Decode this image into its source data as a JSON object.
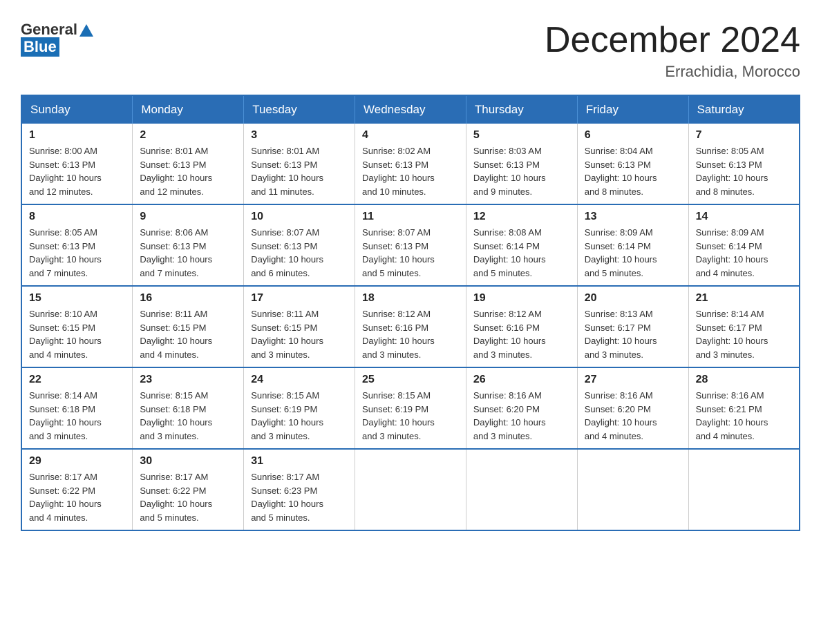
{
  "header": {
    "logo_general": "General",
    "logo_blue": "Blue",
    "month_title": "December 2024",
    "location": "Errachidia, Morocco"
  },
  "days_of_week": [
    "Sunday",
    "Monday",
    "Tuesday",
    "Wednesday",
    "Thursday",
    "Friday",
    "Saturday"
  ],
  "weeks": [
    [
      {
        "day": "1",
        "sunrise": "8:00 AM",
        "sunset": "6:13 PM",
        "daylight": "10 hours and 12 minutes."
      },
      {
        "day": "2",
        "sunrise": "8:01 AM",
        "sunset": "6:13 PM",
        "daylight": "10 hours and 12 minutes."
      },
      {
        "day": "3",
        "sunrise": "8:01 AM",
        "sunset": "6:13 PM",
        "daylight": "10 hours and 11 minutes."
      },
      {
        "day": "4",
        "sunrise": "8:02 AM",
        "sunset": "6:13 PM",
        "daylight": "10 hours and 10 minutes."
      },
      {
        "day": "5",
        "sunrise": "8:03 AM",
        "sunset": "6:13 PM",
        "daylight": "10 hours and 9 minutes."
      },
      {
        "day": "6",
        "sunrise": "8:04 AM",
        "sunset": "6:13 PM",
        "daylight": "10 hours and 8 minutes."
      },
      {
        "day": "7",
        "sunrise": "8:05 AM",
        "sunset": "6:13 PM",
        "daylight": "10 hours and 8 minutes."
      }
    ],
    [
      {
        "day": "8",
        "sunrise": "8:05 AM",
        "sunset": "6:13 PM",
        "daylight": "10 hours and 7 minutes."
      },
      {
        "day": "9",
        "sunrise": "8:06 AM",
        "sunset": "6:13 PM",
        "daylight": "10 hours and 7 minutes."
      },
      {
        "day": "10",
        "sunrise": "8:07 AM",
        "sunset": "6:13 PM",
        "daylight": "10 hours and 6 minutes."
      },
      {
        "day": "11",
        "sunrise": "8:07 AM",
        "sunset": "6:13 PM",
        "daylight": "10 hours and 5 minutes."
      },
      {
        "day": "12",
        "sunrise": "8:08 AM",
        "sunset": "6:14 PM",
        "daylight": "10 hours and 5 minutes."
      },
      {
        "day": "13",
        "sunrise": "8:09 AM",
        "sunset": "6:14 PM",
        "daylight": "10 hours and 5 minutes."
      },
      {
        "day": "14",
        "sunrise": "8:09 AM",
        "sunset": "6:14 PM",
        "daylight": "10 hours and 4 minutes."
      }
    ],
    [
      {
        "day": "15",
        "sunrise": "8:10 AM",
        "sunset": "6:15 PM",
        "daylight": "10 hours and 4 minutes."
      },
      {
        "day": "16",
        "sunrise": "8:11 AM",
        "sunset": "6:15 PM",
        "daylight": "10 hours and 4 minutes."
      },
      {
        "day": "17",
        "sunrise": "8:11 AM",
        "sunset": "6:15 PM",
        "daylight": "10 hours and 3 minutes."
      },
      {
        "day": "18",
        "sunrise": "8:12 AM",
        "sunset": "6:16 PM",
        "daylight": "10 hours and 3 minutes."
      },
      {
        "day": "19",
        "sunrise": "8:12 AM",
        "sunset": "6:16 PM",
        "daylight": "10 hours and 3 minutes."
      },
      {
        "day": "20",
        "sunrise": "8:13 AM",
        "sunset": "6:17 PM",
        "daylight": "10 hours and 3 minutes."
      },
      {
        "day": "21",
        "sunrise": "8:14 AM",
        "sunset": "6:17 PM",
        "daylight": "10 hours and 3 minutes."
      }
    ],
    [
      {
        "day": "22",
        "sunrise": "8:14 AM",
        "sunset": "6:18 PM",
        "daylight": "10 hours and 3 minutes."
      },
      {
        "day": "23",
        "sunrise": "8:15 AM",
        "sunset": "6:18 PM",
        "daylight": "10 hours and 3 minutes."
      },
      {
        "day": "24",
        "sunrise": "8:15 AM",
        "sunset": "6:19 PM",
        "daylight": "10 hours and 3 minutes."
      },
      {
        "day": "25",
        "sunrise": "8:15 AM",
        "sunset": "6:19 PM",
        "daylight": "10 hours and 3 minutes."
      },
      {
        "day": "26",
        "sunrise": "8:16 AM",
        "sunset": "6:20 PM",
        "daylight": "10 hours and 3 minutes."
      },
      {
        "day": "27",
        "sunrise": "8:16 AM",
        "sunset": "6:20 PM",
        "daylight": "10 hours and 4 minutes."
      },
      {
        "day": "28",
        "sunrise": "8:16 AM",
        "sunset": "6:21 PM",
        "daylight": "10 hours and 4 minutes."
      }
    ],
    [
      {
        "day": "29",
        "sunrise": "8:17 AM",
        "sunset": "6:22 PM",
        "daylight": "10 hours and 4 minutes."
      },
      {
        "day": "30",
        "sunrise": "8:17 AM",
        "sunset": "6:22 PM",
        "daylight": "10 hours and 5 minutes."
      },
      {
        "day": "31",
        "sunrise": "8:17 AM",
        "sunset": "6:23 PM",
        "daylight": "10 hours and 5 minutes."
      },
      null,
      null,
      null,
      null
    ]
  ],
  "labels": {
    "sunrise": "Sunrise:",
    "sunset": "Sunset:",
    "daylight": "Daylight:"
  }
}
